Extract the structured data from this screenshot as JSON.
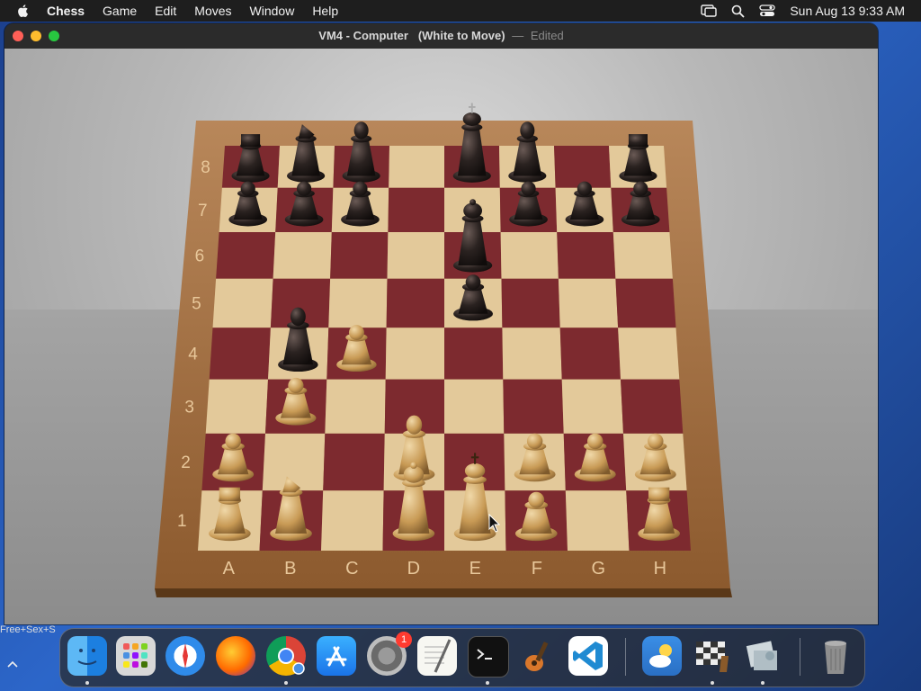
{
  "menubar": {
    "app_name": "Chess",
    "items": [
      "Game",
      "Edit",
      "Moves",
      "Window",
      "Help"
    ],
    "datetime": "Sun Aug 13  9:33 AM"
  },
  "window": {
    "title_main": "VM4 - Computer",
    "title_status": "(White to Move)",
    "title_sep": "—",
    "title_edited": "Edited"
  },
  "board": {
    "files": [
      "A",
      "B",
      "C",
      "D",
      "E",
      "F",
      "G",
      "H"
    ],
    "ranks": [
      "1",
      "2",
      "3",
      "4",
      "5",
      "6",
      "7",
      "8"
    ],
    "pieces": [
      {
        "square": "a8",
        "color": "black",
        "type": "rook"
      },
      {
        "square": "b8",
        "color": "black",
        "type": "knight"
      },
      {
        "square": "c8",
        "color": "black",
        "type": "bishop"
      },
      {
        "square": "e8",
        "color": "black",
        "type": "king"
      },
      {
        "square": "f8",
        "color": "black",
        "type": "bishop"
      },
      {
        "square": "h8",
        "color": "black",
        "type": "rook"
      },
      {
        "square": "a7",
        "color": "black",
        "type": "pawn"
      },
      {
        "square": "b7",
        "color": "black",
        "type": "pawn"
      },
      {
        "square": "c7",
        "color": "black",
        "type": "pawn"
      },
      {
        "square": "f7",
        "color": "black",
        "type": "pawn"
      },
      {
        "square": "g7",
        "color": "black",
        "type": "pawn"
      },
      {
        "square": "h7",
        "color": "black",
        "type": "pawn"
      },
      {
        "square": "e6",
        "color": "black",
        "type": "queen"
      },
      {
        "square": "e5",
        "color": "black",
        "type": "pawn"
      },
      {
        "square": "b4",
        "color": "black",
        "type": "bishop"
      },
      {
        "square": "c4",
        "color": "white",
        "type": "pawn"
      },
      {
        "square": "b3",
        "color": "white",
        "type": "pawn"
      },
      {
        "square": "a2",
        "color": "white",
        "type": "pawn"
      },
      {
        "square": "d2",
        "color": "white",
        "type": "bishop"
      },
      {
        "square": "f2",
        "color": "white",
        "type": "pawn"
      },
      {
        "square": "g2",
        "color": "white",
        "type": "pawn"
      },
      {
        "square": "h2",
        "color": "white",
        "type": "pawn"
      },
      {
        "square": "a1",
        "color": "white",
        "type": "rook"
      },
      {
        "square": "b1",
        "color": "white",
        "type": "knight"
      },
      {
        "square": "d1",
        "color": "white",
        "type": "queen"
      },
      {
        "square": "e1",
        "color": "white",
        "type": "king"
      },
      {
        "square": "f1",
        "color": "white",
        "type": "pawn"
      },
      {
        "square": "h1",
        "color": "white",
        "type": "rook"
      }
    ]
  },
  "left_peek_text": "Free+Sex+S",
  "dock": {
    "items": [
      {
        "name": "Finder",
        "icon": "finder-icon",
        "running": true
      },
      {
        "name": "Launchpad",
        "icon": "launchpad-icon",
        "running": false
      },
      {
        "name": "Safari",
        "icon": "safari-icon",
        "running": false
      },
      {
        "name": "Firefox",
        "icon": "firefox-icon",
        "running": false
      },
      {
        "name": "Google Chrome",
        "icon": "chrome-icon",
        "running": true
      },
      {
        "name": "App Store",
        "icon": "app-store-icon",
        "running": false
      },
      {
        "name": "System Settings",
        "icon": "settings-icon",
        "running": false,
        "badge": "1"
      },
      {
        "name": "TextEdit",
        "icon": "textedit-icon",
        "running": false
      },
      {
        "name": "Terminal",
        "icon": "terminal-icon",
        "running": true
      },
      {
        "name": "GarageBand",
        "icon": "garageband-icon",
        "running": false
      },
      {
        "name": "Visual Studio Code",
        "icon": "vscode-icon",
        "running": false
      },
      {
        "name": "Weather",
        "icon": "weather-icon",
        "running": false
      },
      {
        "name": "Chess",
        "icon": "chess-icon",
        "running": true
      },
      {
        "name": "Preview",
        "icon": "preview-icon",
        "running": true
      },
      {
        "name": "Trash",
        "icon": "trash-icon",
        "running": false
      }
    ]
  },
  "colors": {
    "light_square": "#e3c99a",
    "dark_square": "#7d2a2f",
    "frame": "#a0703f",
    "white_piece": "#c89a55",
    "black_piece": "#2a2220"
  }
}
